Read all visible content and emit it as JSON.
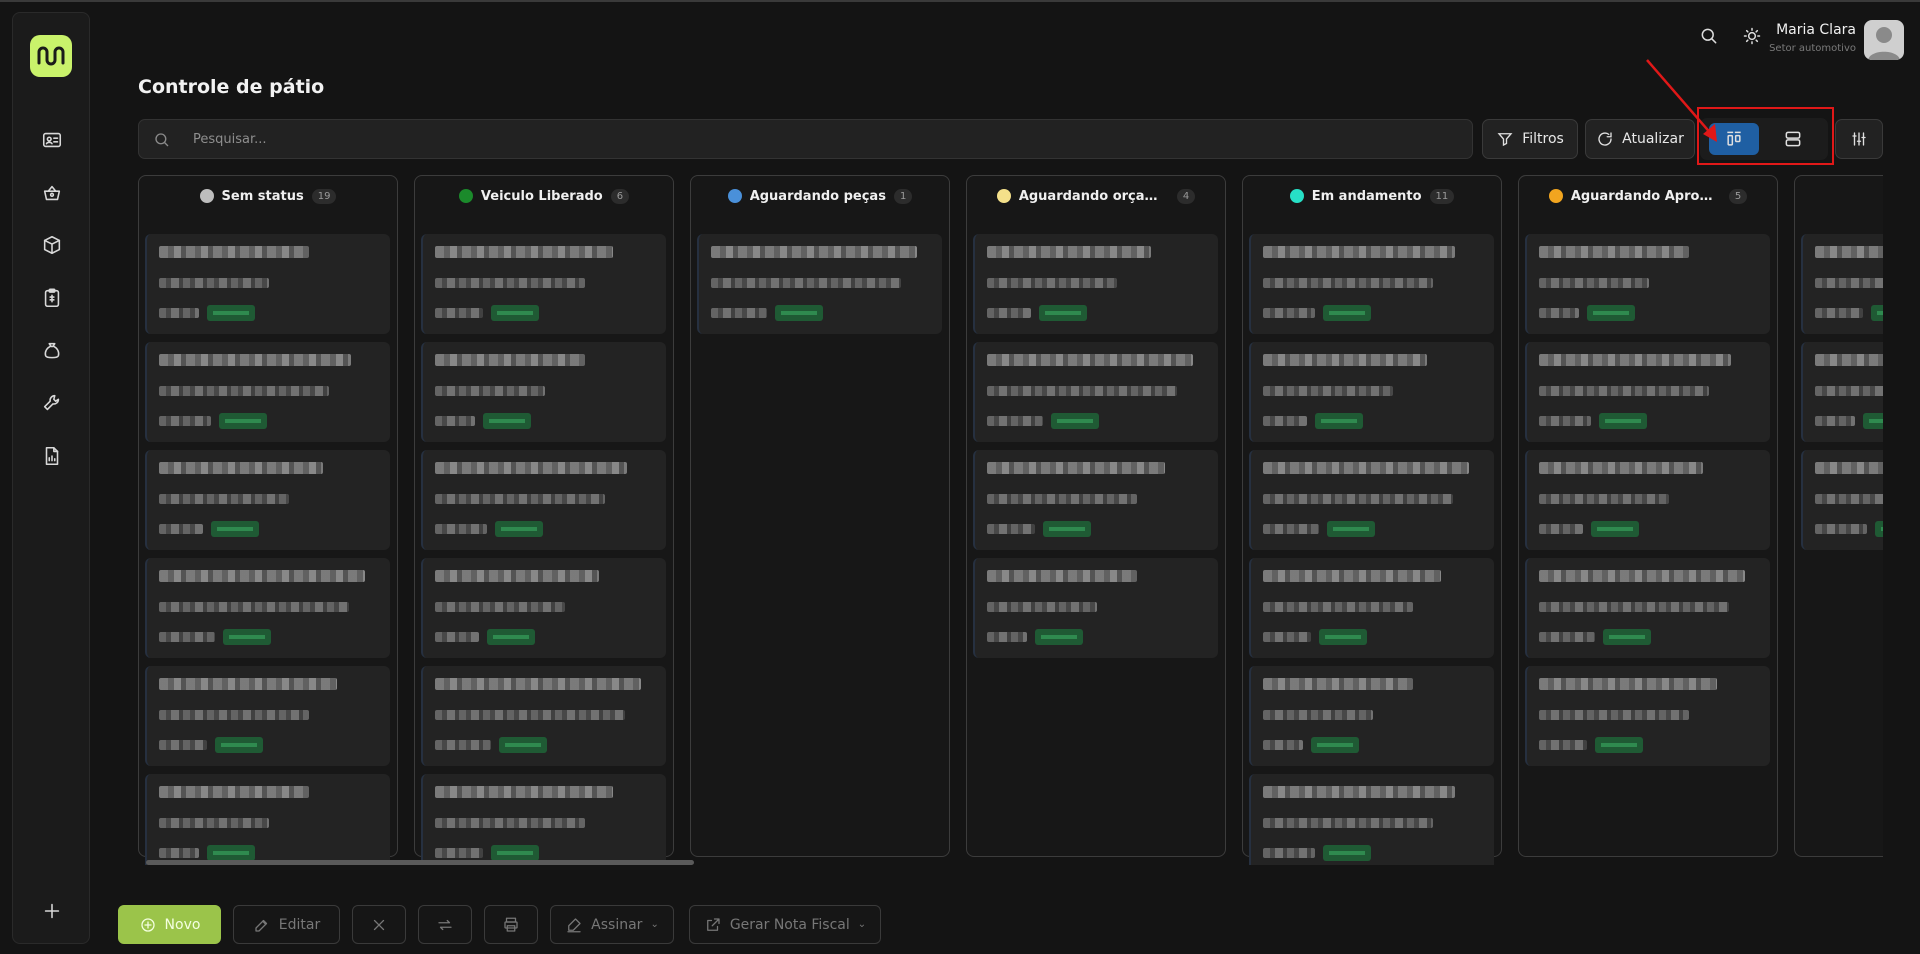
{
  "header": {
    "user_name": "Maria Clara",
    "user_role": "Setor automotivo",
    "page_title": "Controle de pátio"
  },
  "toolbar": {
    "search_placeholder": "Pesquisar...",
    "filters_label": "Filtros",
    "refresh_label": "Atualizar"
  },
  "sidebar": {
    "items": [
      "id-card-icon",
      "basket-icon",
      "box-icon",
      "clipboard-icon",
      "money-bag-icon",
      "wrench-icon",
      "report-icon"
    ],
    "add": "plus-icon"
  },
  "columns": [
    {
      "title": "Sem status",
      "count": "19",
      "color": "#bdbdbd",
      "cards": 6
    },
    {
      "title": "Veiculo Liberado",
      "count": "6",
      "color": "#1b8a2b",
      "cards": 6
    },
    {
      "title": "Aguardando peças",
      "count": "1",
      "color": "#4a90d9",
      "cards": 1
    },
    {
      "title": "Aguardando orçame...",
      "count": "4",
      "color": "#f4e08a",
      "cards": 4
    },
    {
      "title": "Em andamento",
      "count": "11",
      "color": "#27e0c6",
      "cards": 6
    },
    {
      "title": "Aguardando Aprovaç...",
      "count": "5",
      "color": "#f2a51f",
      "cards": 5
    },
    {
      "title": "",
      "count": "",
      "color": "#e31b1b",
      "cards": 3
    }
  ],
  "bottom": {
    "new_label": "Novo",
    "edit_label": "Editar",
    "sign_label": "Assinar",
    "invoice_label": "Gerar Nota Fiscal"
  },
  "colors": {
    "accent": "#c9f26b",
    "primary_button": "#9bc44a",
    "active_view": "#1f5fa3",
    "highlight": "#e01818"
  }
}
